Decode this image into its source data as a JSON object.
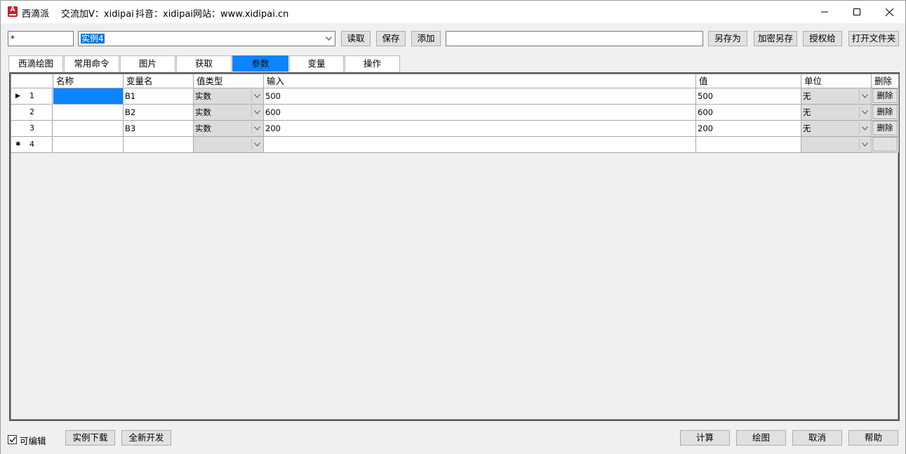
{
  "window": {
    "app_name": "西滴派",
    "info_1": "交流加V：xidipai",
    "info_2": "抖音：xidipai",
    "info_3": "网站：www.xidipai.cn"
  },
  "toolbar": {
    "left_field_value": "*",
    "combo_value": "实例4",
    "read_label": "读取",
    "save_label": "保存",
    "add_label": "添加",
    "path_field_value": "",
    "save_as_label": "另存为",
    "encrypt_save_label": "加密另存",
    "authorize_label": "授权给",
    "open_folder_label": "打开文件夹"
  },
  "tabs": [
    {
      "label": "西滴绘图"
    },
    {
      "label": "常用命令"
    },
    {
      "label": "图片"
    },
    {
      "label": "获取"
    },
    {
      "label": "参数",
      "active": true
    },
    {
      "label": "变量"
    },
    {
      "label": "操作"
    }
  ],
  "grid": {
    "columns": [
      "名称",
      "变量名",
      "值类型",
      "输入",
      "值",
      "单位",
      "删除"
    ],
    "rows": [
      {
        "num": "1",
        "name": "",
        "var": "B1",
        "type": "实数",
        "input": "500",
        "value": "500",
        "unit": "无",
        "delete": "删除"
      },
      {
        "num": "2",
        "name": "",
        "var": "B2",
        "type": "实数",
        "input": "600",
        "value": "600",
        "unit": "无",
        "delete": "删除"
      },
      {
        "num": "3",
        "name": "",
        "var": "B3",
        "type": "实数",
        "input": "200",
        "value": "200",
        "unit": "无",
        "delete": "删除"
      },
      {
        "num": "4",
        "name": "",
        "var": "",
        "type": "",
        "input": "",
        "value": "",
        "unit": "",
        "delete": ""
      }
    ]
  },
  "bottom": {
    "editable_label": "可编辑",
    "editable_checked": true,
    "download_label": "实例下载",
    "new_dev_label": "全新开发",
    "calc_label": "计算",
    "draw_label": "绘图",
    "cancel_label": "取消",
    "help_label": "帮助"
  },
  "colors": {
    "selection": "#0a84ff",
    "brand_icon": "#d11a2a"
  }
}
